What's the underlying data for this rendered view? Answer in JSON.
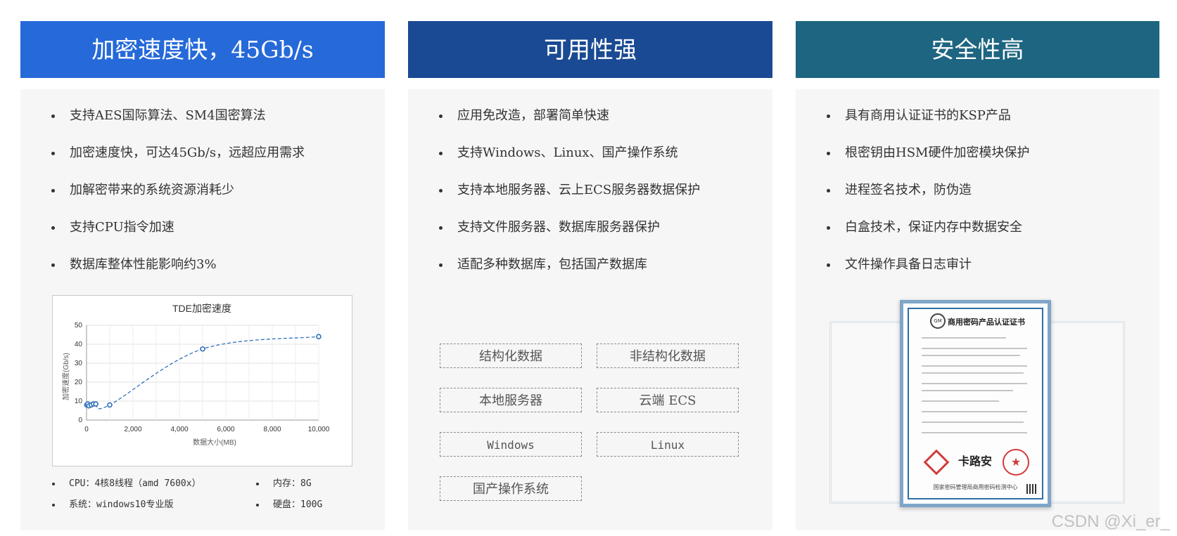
{
  "columns": [
    {
      "header": "加密速度快，45Gb/s",
      "features": [
        "支持AES国际算法、SM4国密算法",
        "加密速度快，可达45Gb/s，远超应用需求",
        "加解密带来的系统资源消耗少",
        "支持CPU指令加速",
        "数据库整体性能影响约3%"
      ],
      "specs": [
        "CPU：4核8线程（amd 7600x）",
        "内存：8G",
        "系统：windows10专业版",
        "硬盘：100G"
      ]
    },
    {
      "header": "可用性强",
      "features": [
        "应用免改造，部署简单快速",
        "支持Windows、Linux、国产操作系统",
        "支持本地服务器、云上ECS服务器数据保护",
        "支持文件服务器、数据库服务器保护",
        "适配多种数据库，包括国产数据库"
      ],
      "tags": [
        "结构化数据",
        "非结构化数据",
        "本地服务器",
        "云端 ECS",
        "Windows",
        "Linux",
        "国产操作系统"
      ]
    },
    {
      "header": "安全性高",
      "features": [
        "具有商用认证证书的KSP产品",
        "根密钥由HSM硬件加密模块保护",
        "进程签名技术，防伪造",
        "白盒技术，保证内存中数据安全",
        "文件操作具备日志审计"
      ],
      "certificate": {
        "title": "商用密码产品认证证书",
        "logo": "GM",
        "brand": "卡路安",
        "footer": "国家密码管理局商用密码检测中心"
      }
    }
  ],
  "chart_data": {
    "type": "line",
    "title": "TDE加密速度",
    "xlabel": "数据大小(MB)",
    "ylabel": "加密速度(Gb/s)",
    "xlim": [
      0,
      10000
    ],
    "ylim": [
      0,
      50
    ],
    "xticks": [
      "0",
      "2,000",
      "4,000",
      "6,000",
      "8,000",
      "10,000"
    ],
    "yticks": [
      "0",
      "10",
      "20",
      "30",
      "40",
      "50"
    ],
    "x": [
      10,
      50,
      100,
      200,
      300,
      400,
      1000,
      5000,
      10000
    ],
    "y": [
      8,
      8.5,
      7.5,
      8,
      8.5,
      8.5,
      8,
      37.5,
      44
    ],
    "grid": true,
    "line_color": "#2e6fbd"
  },
  "watermark": "CSDN @Xi_er_"
}
